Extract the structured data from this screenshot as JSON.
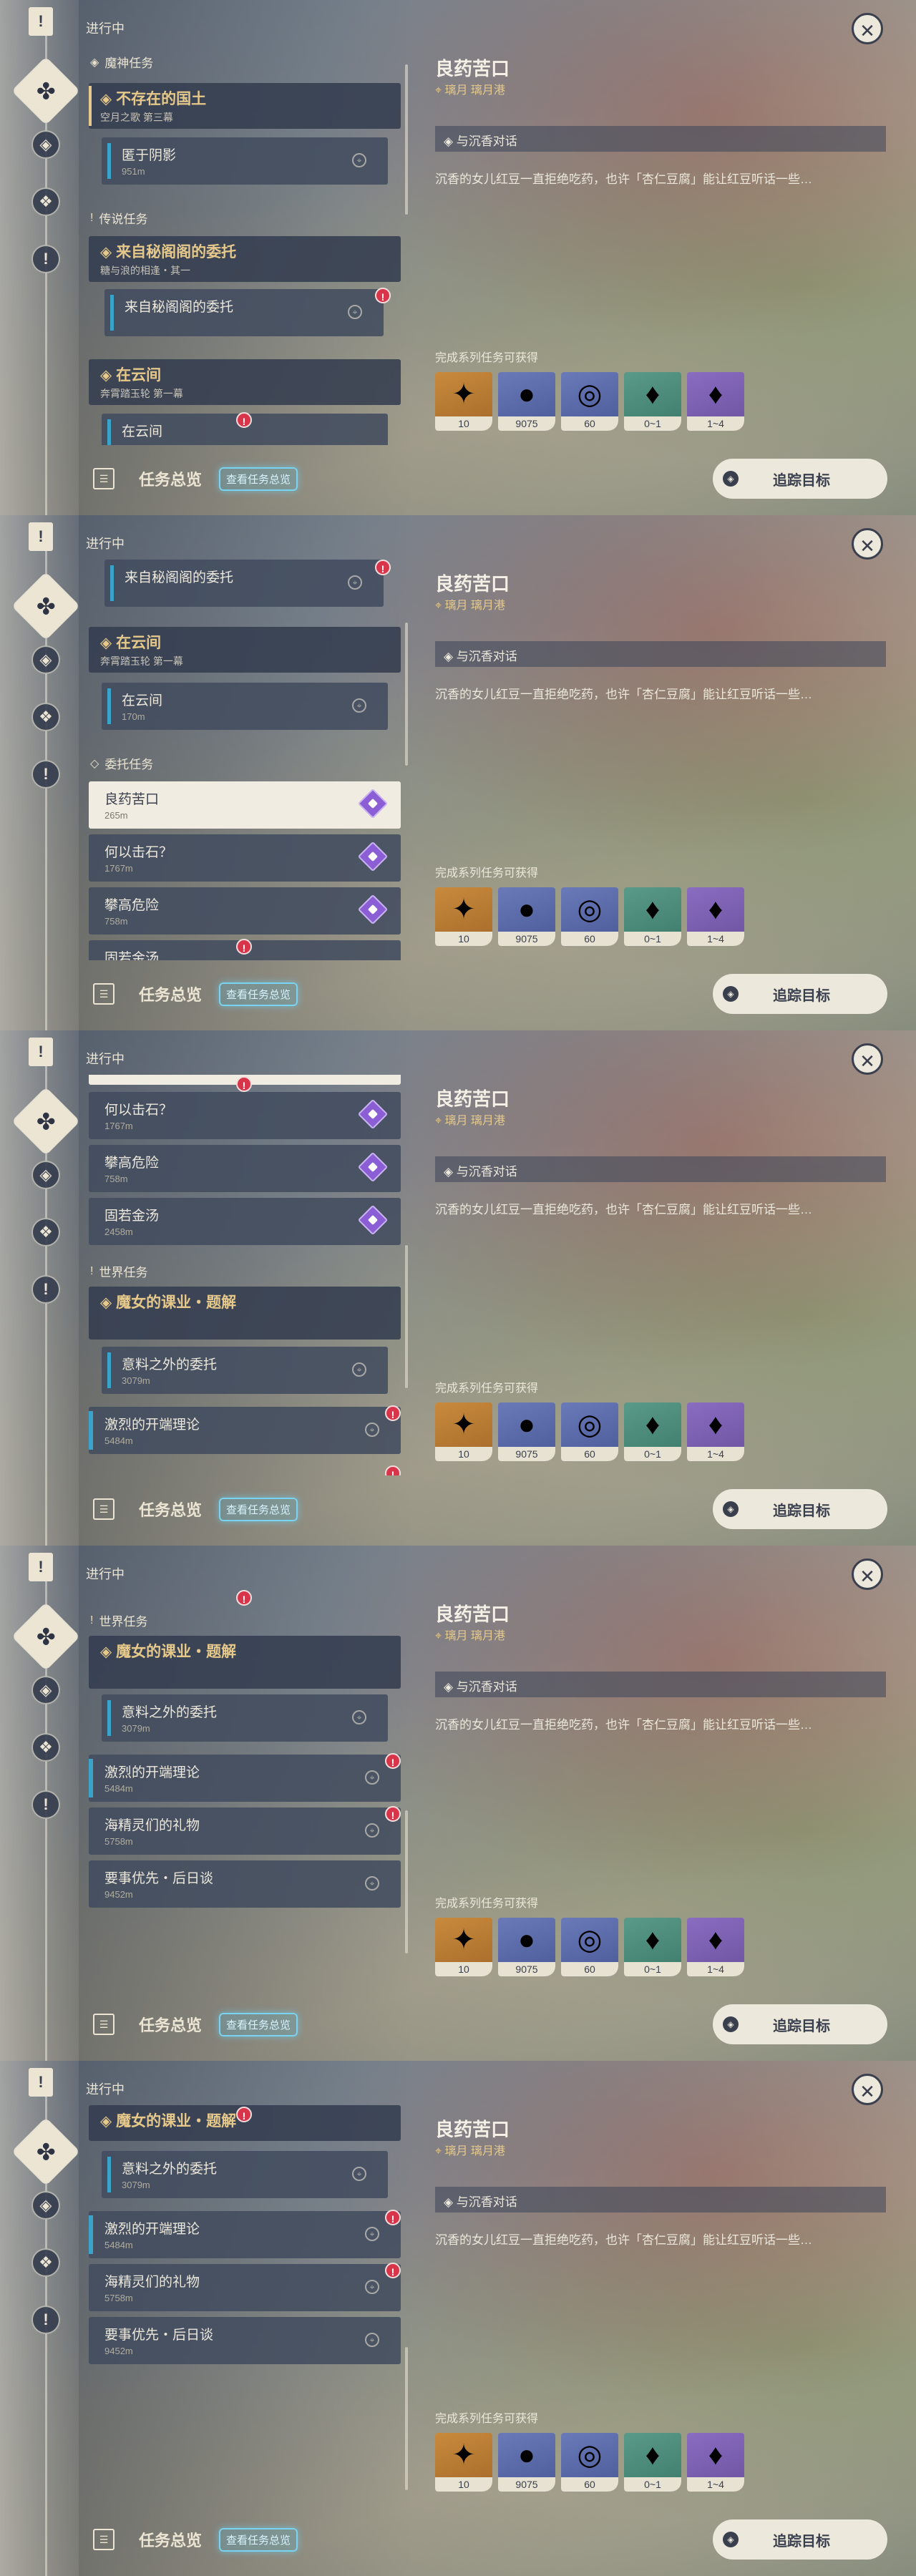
{
  "header": {
    "in_progress": "进行中"
  },
  "categories": {
    "archon": "魔神任务",
    "legend": "传说任务",
    "commission": "委托任务",
    "world": "世界任务"
  },
  "quests": {
    "nonexistent_land": {
      "title": "不存在的国土",
      "subtitle": "空月之歌 第三幕"
    },
    "shadow": {
      "title": "匿于阴影",
      "distance": "951m"
    },
    "pavilion": {
      "title": "来自秘阁阁的委托",
      "subtitle": "糖与浪的相逢・其一"
    },
    "pavilion_item": {
      "title": "来自秘阁阁的委托"
    },
    "yunjian": {
      "title": "在云间",
      "subtitle": "奔霄踏玉轮 第一幕"
    },
    "yunjian_item": {
      "title": "在云间",
      "distance": "170m"
    },
    "liangyao": {
      "title": "良药苦口",
      "distance": "265m"
    },
    "heyi": {
      "title": "何以击石？",
      "distance": "1767m"
    },
    "pangao": {
      "title": "攀高危险",
      "distance": "758m"
    },
    "guruo": {
      "title": "固若金汤",
      "distance": "2458m"
    },
    "witch": {
      "title": "魔女的课业・题解"
    },
    "yiliao": {
      "title": "意料之外的委托",
      "distance": "3079m"
    },
    "jilie": {
      "title": "激烈的开端理论",
      "distance": "5484m"
    },
    "haijing": {
      "title": "海精灵们的礼物",
      "distance": "5758m"
    },
    "yaoshi": {
      "title": "要事优先・后日谈",
      "distance": "9452m"
    },
    "cut_yunjian": "在云间",
    "cut_guruo": "固若金汤"
  },
  "bottom": {
    "overview_label": "任务总览",
    "overview_button": "查看任务总览",
    "track_label": "追踪目标"
  },
  "detail": {
    "title": "良药苦口",
    "location": "璃月 璃月港",
    "objective": "与沉香对话",
    "description": "沉香的女儿红豆一直拒绝吃药，也许「杏仁豆腐」能让红豆听话一些…",
    "rewards_label": "完成系列任务可获得",
    "rewards": [
      {
        "icon": "primogem-icon",
        "count": "10",
        "tone": "gold"
      },
      {
        "icon": "mora-icon",
        "count": "9075",
        "tone": "blue"
      },
      {
        "icon": "adventure-exp-icon",
        "count": "60",
        "tone": "blue"
      },
      {
        "icon": "crystal-icon",
        "count": "0~1",
        "tone": "green"
      },
      {
        "icon": "crystal-icon",
        "count": "1~4",
        "tone": "purple"
      }
    ]
  },
  "colors": {
    "accent_gold": "#e6c98a",
    "alert_red": "#d8344a",
    "commission_purple": "#8b5ed6",
    "bar_blue": "#3aa3c9"
  }
}
